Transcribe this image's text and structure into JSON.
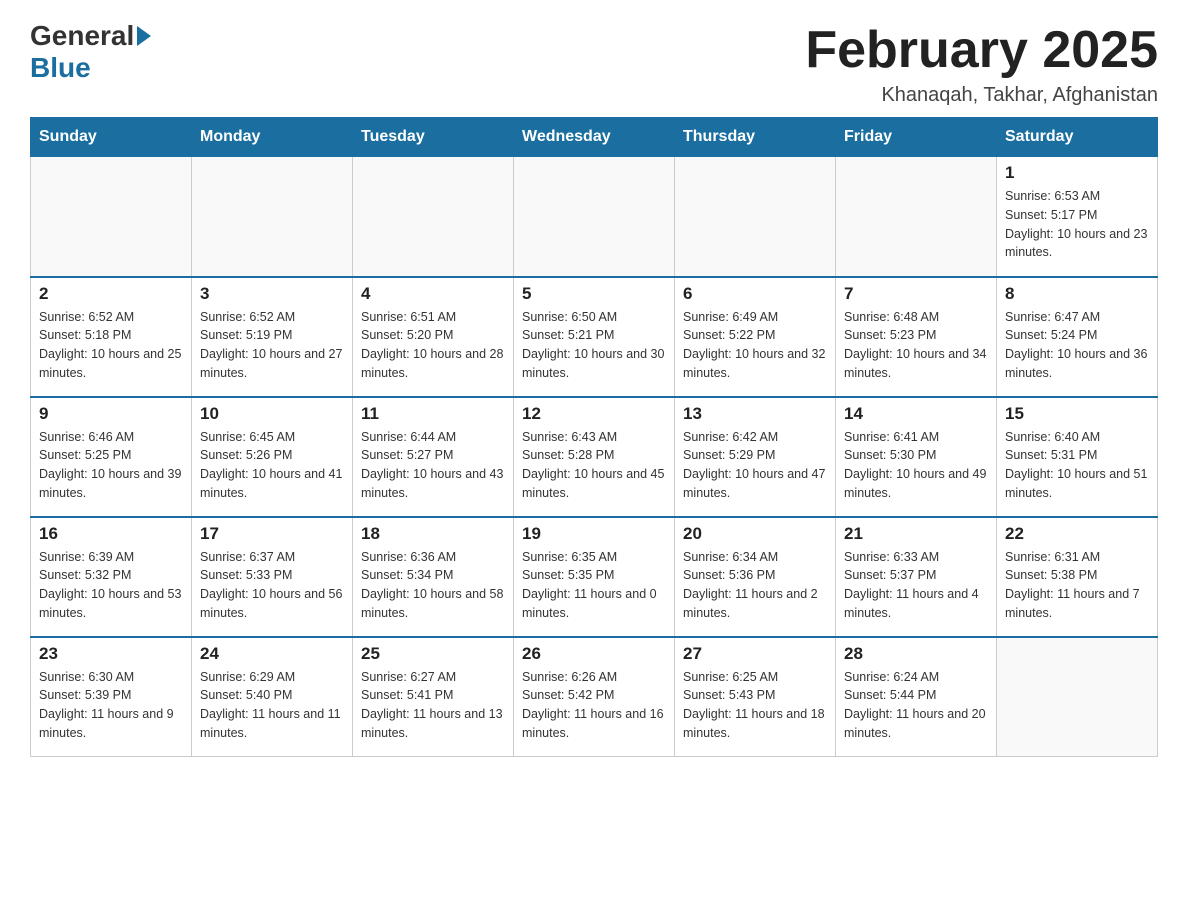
{
  "header": {
    "logo_general": "General",
    "logo_blue": "Blue",
    "month_title": "February 2025",
    "location": "Khanaqah, Takhar, Afghanistan"
  },
  "weekdays": [
    "Sunday",
    "Monday",
    "Tuesday",
    "Wednesday",
    "Thursday",
    "Friday",
    "Saturday"
  ],
  "weeks": [
    [
      {
        "day": "",
        "info": ""
      },
      {
        "day": "",
        "info": ""
      },
      {
        "day": "",
        "info": ""
      },
      {
        "day": "",
        "info": ""
      },
      {
        "day": "",
        "info": ""
      },
      {
        "day": "",
        "info": ""
      },
      {
        "day": "1",
        "info": "Sunrise: 6:53 AM\nSunset: 5:17 PM\nDaylight: 10 hours and 23 minutes."
      }
    ],
    [
      {
        "day": "2",
        "info": "Sunrise: 6:52 AM\nSunset: 5:18 PM\nDaylight: 10 hours and 25 minutes."
      },
      {
        "day": "3",
        "info": "Sunrise: 6:52 AM\nSunset: 5:19 PM\nDaylight: 10 hours and 27 minutes."
      },
      {
        "day": "4",
        "info": "Sunrise: 6:51 AM\nSunset: 5:20 PM\nDaylight: 10 hours and 28 minutes."
      },
      {
        "day": "5",
        "info": "Sunrise: 6:50 AM\nSunset: 5:21 PM\nDaylight: 10 hours and 30 minutes."
      },
      {
        "day": "6",
        "info": "Sunrise: 6:49 AM\nSunset: 5:22 PM\nDaylight: 10 hours and 32 minutes."
      },
      {
        "day": "7",
        "info": "Sunrise: 6:48 AM\nSunset: 5:23 PM\nDaylight: 10 hours and 34 minutes."
      },
      {
        "day": "8",
        "info": "Sunrise: 6:47 AM\nSunset: 5:24 PM\nDaylight: 10 hours and 36 minutes."
      }
    ],
    [
      {
        "day": "9",
        "info": "Sunrise: 6:46 AM\nSunset: 5:25 PM\nDaylight: 10 hours and 39 minutes."
      },
      {
        "day": "10",
        "info": "Sunrise: 6:45 AM\nSunset: 5:26 PM\nDaylight: 10 hours and 41 minutes."
      },
      {
        "day": "11",
        "info": "Sunrise: 6:44 AM\nSunset: 5:27 PM\nDaylight: 10 hours and 43 minutes."
      },
      {
        "day": "12",
        "info": "Sunrise: 6:43 AM\nSunset: 5:28 PM\nDaylight: 10 hours and 45 minutes."
      },
      {
        "day": "13",
        "info": "Sunrise: 6:42 AM\nSunset: 5:29 PM\nDaylight: 10 hours and 47 minutes."
      },
      {
        "day": "14",
        "info": "Sunrise: 6:41 AM\nSunset: 5:30 PM\nDaylight: 10 hours and 49 minutes."
      },
      {
        "day": "15",
        "info": "Sunrise: 6:40 AM\nSunset: 5:31 PM\nDaylight: 10 hours and 51 minutes."
      }
    ],
    [
      {
        "day": "16",
        "info": "Sunrise: 6:39 AM\nSunset: 5:32 PM\nDaylight: 10 hours and 53 minutes."
      },
      {
        "day": "17",
        "info": "Sunrise: 6:37 AM\nSunset: 5:33 PM\nDaylight: 10 hours and 56 minutes."
      },
      {
        "day": "18",
        "info": "Sunrise: 6:36 AM\nSunset: 5:34 PM\nDaylight: 10 hours and 58 minutes."
      },
      {
        "day": "19",
        "info": "Sunrise: 6:35 AM\nSunset: 5:35 PM\nDaylight: 11 hours and 0 minutes."
      },
      {
        "day": "20",
        "info": "Sunrise: 6:34 AM\nSunset: 5:36 PM\nDaylight: 11 hours and 2 minutes."
      },
      {
        "day": "21",
        "info": "Sunrise: 6:33 AM\nSunset: 5:37 PM\nDaylight: 11 hours and 4 minutes."
      },
      {
        "day": "22",
        "info": "Sunrise: 6:31 AM\nSunset: 5:38 PM\nDaylight: 11 hours and 7 minutes."
      }
    ],
    [
      {
        "day": "23",
        "info": "Sunrise: 6:30 AM\nSunset: 5:39 PM\nDaylight: 11 hours and 9 minutes."
      },
      {
        "day": "24",
        "info": "Sunrise: 6:29 AM\nSunset: 5:40 PM\nDaylight: 11 hours and 11 minutes."
      },
      {
        "day": "25",
        "info": "Sunrise: 6:27 AM\nSunset: 5:41 PM\nDaylight: 11 hours and 13 minutes."
      },
      {
        "day": "26",
        "info": "Sunrise: 6:26 AM\nSunset: 5:42 PM\nDaylight: 11 hours and 16 minutes."
      },
      {
        "day": "27",
        "info": "Sunrise: 6:25 AM\nSunset: 5:43 PM\nDaylight: 11 hours and 18 minutes."
      },
      {
        "day": "28",
        "info": "Sunrise: 6:24 AM\nSunset: 5:44 PM\nDaylight: 11 hours and 20 minutes."
      },
      {
        "day": "",
        "info": ""
      }
    ]
  ]
}
